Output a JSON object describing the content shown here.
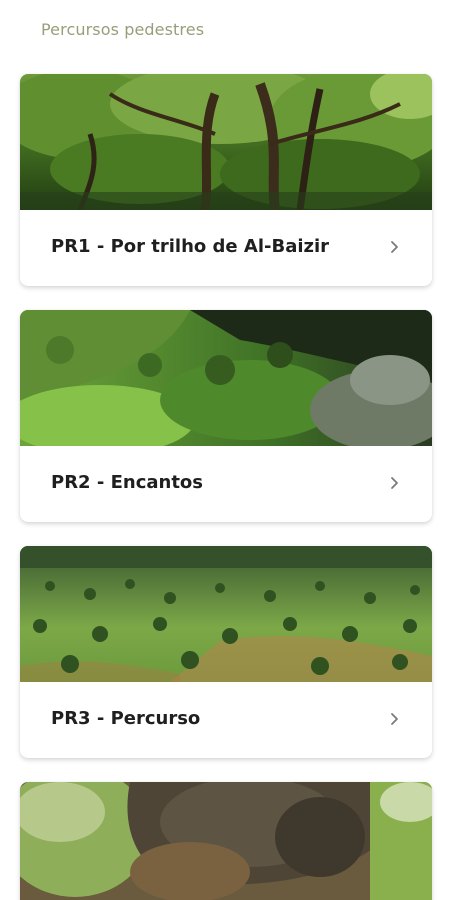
{
  "section": {
    "title": "Percursos pedestres"
  },
  "trails": [
    {
      "title": "PR1 - Por trilho de Al-Baizir",
      "image": "cork-oak-forest-photo"
    },
    {
      "title": "PR2 - Encantos",
      "image": "green-hillside-photo"
    },
    {
      "title": "PR3 - Percurso",
      "image": "montado-plain-photo"
    },
    {
      "image": "rock-outcrop-photo"
    }
  ],
  "icons": {
    "open": "chevron-right-icon"
  },
  "colors": {
    "section_title": "#9a9d7a",
    "card_title": "#1f1f1f",
    "chevron": "#7a7a7a"
  }
}
